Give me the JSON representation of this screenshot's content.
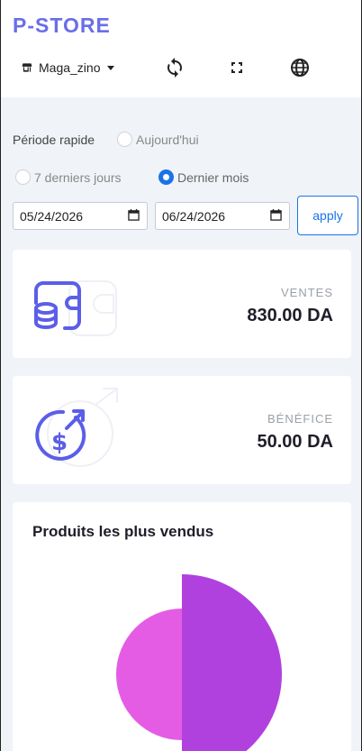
{
  "header": {
    "brand": "P-STORE",
    "store_name": "Maga_zino",
    "icons": [
      "store-icon",
      "caret-down-icon",
      "refresh-icon",
      "fullscreen-icon",
      "globe-icon"
    ]
  },
  "filters": {
    "period_label": "Période rapide",
    "options": [
      {
        "label": "Aujourd'hui",
        "checked": false
      },
      {
        "label": "7 derniers jours",
        "checked": false
      },
      {
        "label": "Dernier mois",
        "checked": true
      }
    ],
    "date_from": "05/24/2026",
    "date_to": "06/24/2026",
    "apply_label": "apply"
  },
  "stats": {
    "sales_label": "VENTES",
    "sales_value": "830.00 DA",
    "profit_label": "BÉNÉFICE",
    "profit_value": "50.00 DA"
  },
  "top_products": {
    "title": "Produits les plus vendus"
  },
  "colors": {
    "brand": "#6a6ee8",
    "accent": "#1a73e8",
    "slice_a": "#b041de",
    "slice_b": "#e45ce4"
  },
  "chart_data": {
    "type": "pie",
    "title": "Produits les plus vendus",
    "values": [
      50,
      50
    ],
    "colors": [
      "#b041de",
      "#e45ce4"
    ]
  }
}
